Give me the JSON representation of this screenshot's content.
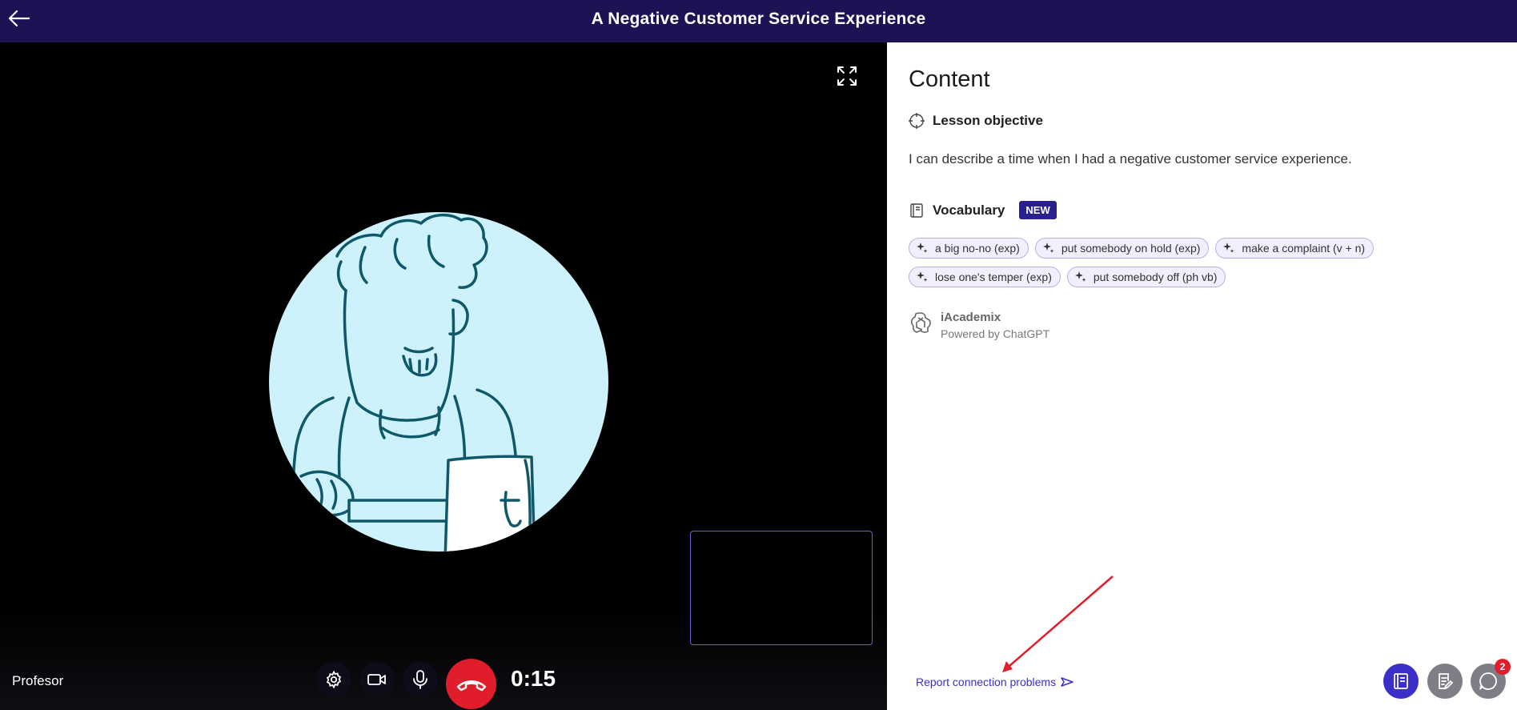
{
  "header": {
    "title": "A Negative Customer Service Experience"
  },
  "video": {
    "participant_name": "Profesor",
    "timer": "0:15"
  },
  "content": {
    "heading": "Content",
    "objective_label": "Lesson objective",
    "objective_text": "I can describe a time when I had a negative customer service experience.",
    "vocabulary_label": "Vocabulary",
    "new_badge": "NEW",
    "vocabulary": [
      "a big no-no (exp)",
      "put somebody on hold (exp)",
      "make a complaint (v + n)",
      "lose one's temper (exp)",
      "put somebody off (ph vb)"
    ],
    "ai_name": "iAcademix",
    "ai_powered": "Powered by ChatGPT"
  },
  "footer": {
    "report_link": "Report connection problems",
    "chat_badge": "2"
  },
  "colors": {
    "header": "#1c1355",
    "accent": "#3b2fc9",
    "hangup": "#e11d2b"
  }
}
